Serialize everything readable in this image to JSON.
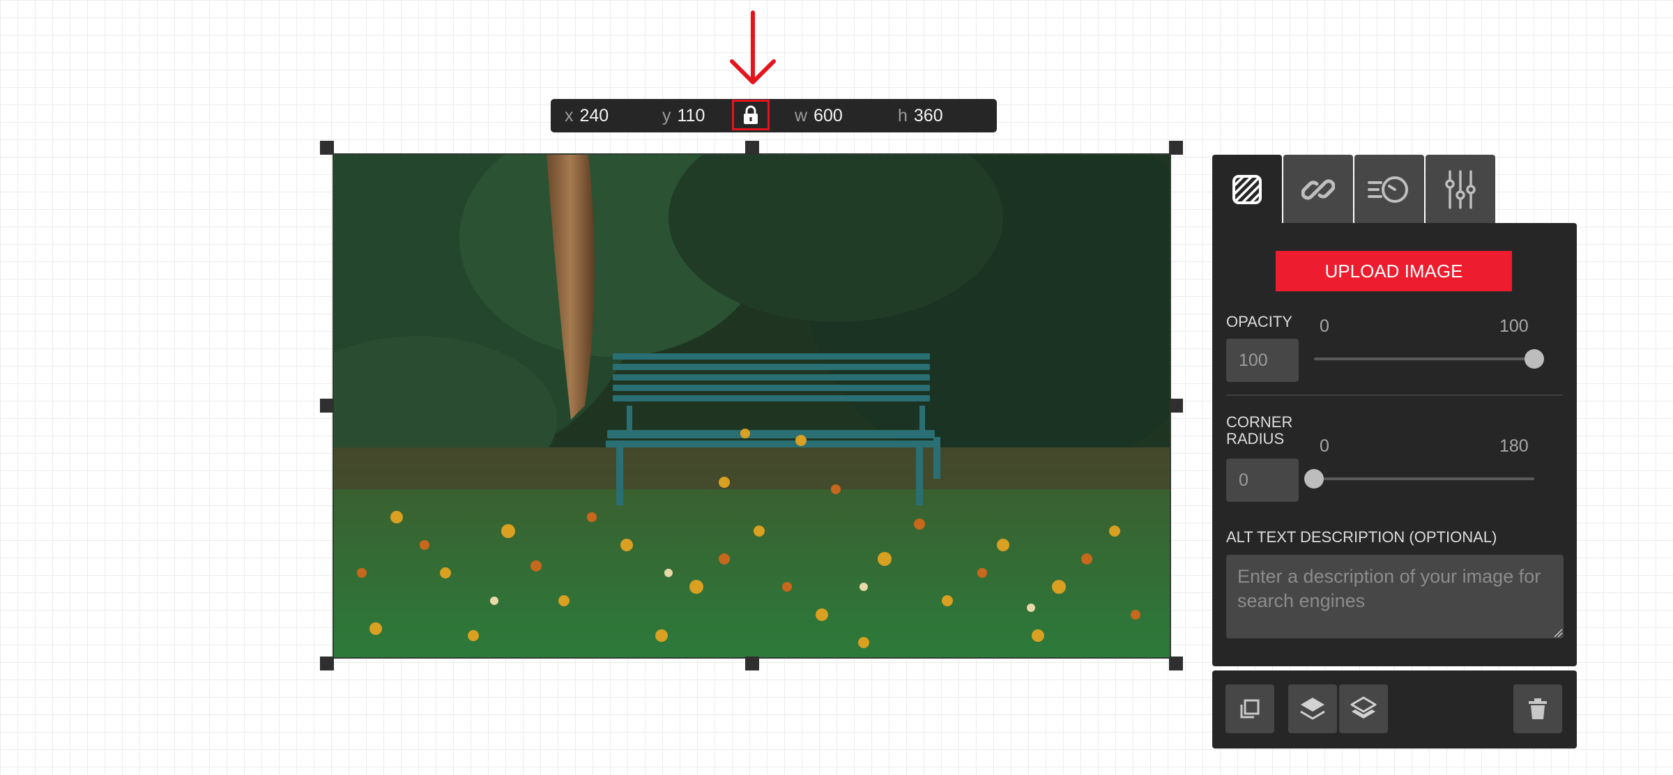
{
  "toolbar": {
    "x": {
      "label": "x",
      "value": "240"
    },
    "y": {
      "label": "y",
      "value": "110"
    },
    "w": {
      "label": "w",
      "value": "600"
    },
    "h": {
      "label": "h",
      "value": "360"
    },
    "lock_icon": "padlock-icon"
  },
  "annotation": {
    "arrow_color": "#e5141c",
    "icon": "down-arrow-icon"
  },
  "tabs": [
    {
      "icon": "image-fill-icon",
      "active": true
    },
    {
      "icon": "link-icon",
      "active": false
    },
    {
      "icon": "animation-speed-icon",
      "active": false
    },
    {
      "icon": "sliders-icon",
      "active": false
    }
  ],
  "panel": {
    "upload_label": "UPLOAD IMAGE",
    "opacity": {
      "label": "OPACITY",
      "value": "100",
      "min_label": "0",
      "max_label": "100",
      "level": 1.0
    },
    "corner_radius": {
      "label": "CORNER RADIUS",
      "value": "0",
      "min_label": "0",
      "max_label": "180",
      "level": 0.0
    },
    "alt_text": {
      "label": "ALT TEXT DESCRIPTION (OPTIONAL)",
      "placeholder": "Enter a description of your image for search engines",
      "value": ""
    }
  },
  "actions": [
    {
      "icon": "duplicate-icon"
    },
    {
      "icon": "layer-up-icon"
    },
    {
      "icon": "layer-down-icon"
    },
    {
      "icon": "trash-icon"
    }
  ],
  "colors": {
    "accent": "#ed1c2e",
    "panel_bg": "#262626",
    "control_bg": "#474747"
  }
}
